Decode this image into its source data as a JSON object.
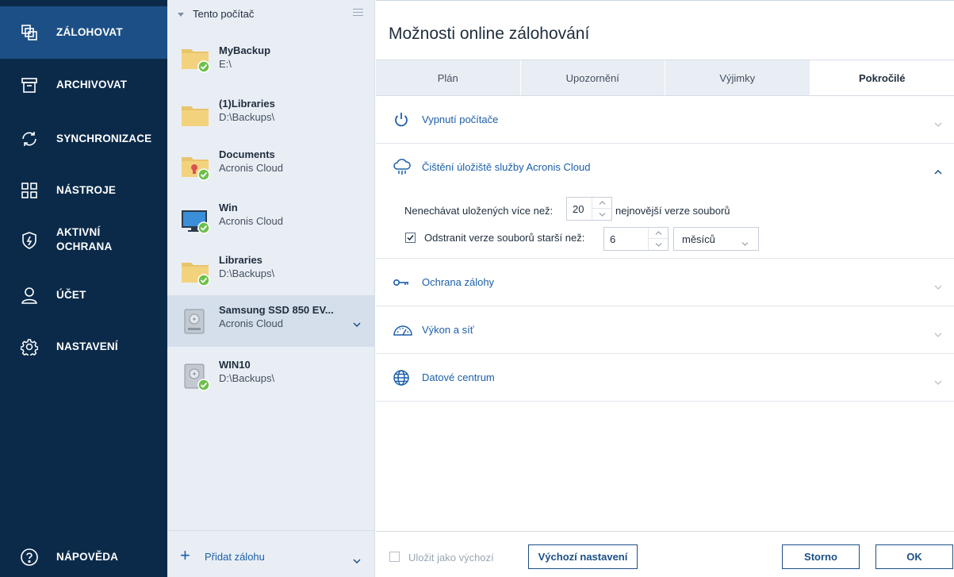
{
  "nav": {
    "items": [
      {
        "label": "ZÁLOHOVAT",
        "icon": "backup-icon"
      },
      {
        "label": "ARCHIVOVAT",
        "icon": "archive-icon"
      },
      {
        "label": "SYNCHRONIZACE",
        "icon": "sync-icon"
      },
      {
        "label": "NÁSTROJE",
        "icon": "tools-grid-icon"
      },
      {
        "label": "AKTIVNÍ",
        "label2": "OCHRANA",
        "icon": "shield-icon"
      },
      {
        "label": "ÚČET",
        "icon": "user-icon"
      },
      {
        "label": "NASTAVENÍ",
        "icon": "gear-icon"
      }
    ],
    "help": "NÁPOVĚDA"
  },
  "list": {
    "header": "Tento počítač",
    "backups": [
      {
        "name": "MyBackup",
        "dest": "E:\\"
      },
      {
        "name": "(1)Libraries",
        "dest": "D:\\Backups\\"
      },
      {
        "name": "Documents",
        "dest": "Acronis Cloud"
      },
      {
        "name": "Win",
        "dest": "Acronis Cloud"
      },
      {
        "name": "Libraries",
        "dest": "D:\\Backups\\"
      },
      {
        "name": "Samsung SSD 850 EV...",
        "dest": "Acronis Cloud"
      },
      {
        "name": "WIN10",
        "dest": "D:\\Backups\\"
      }
    ],
    "add": "Přidat zálohu"
  },
  "panel": {
    "title": "Možnosti online zálohování",
    "tabs": [
      "Plán",
      "Upozornění",
      "Výjimky",
      "Pokročilé"
    ],
    "sections": {
      "shutdown": "Vypnutí počítače",
      "cleanup": "Čištění úložiště služby Acronis Cloud",
      "protection": "Ochrana zálohy",
      "performance": "Výkon a síť",
      "datacenter": "Datové centrum"
    },
    "cleanup": {
      "keep_label": "Nenechávat uložených více než:",
      "keep_value": "20",
      "keep_suffix": "nejnovější verze souborů",
      "delete_label": "Odstranit verze souborů starší než:",
      "delete_value": "6",
      "unit": "měsíců"
    }
  },
  "footer": {
    "save_default": "Uložit jako výchozí",
    "defaults": "Výchozí nastavení",
    "cancel": "Storno",
    "ok": "OK"
  },
  "colors": {
    "nav_bg": "#0b2a4a",
    "nav_active": "#1c4f85",
    "accent": "#1c5fa8",
    "ok_green": "#6cc04a"
  }
}
